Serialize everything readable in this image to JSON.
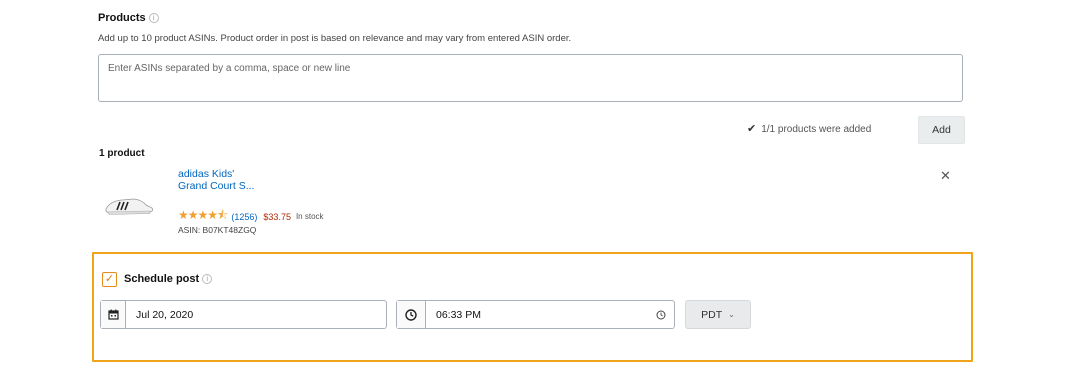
{
  "products": {
    "title": "Products",
    "description": "Add up to 10 product ASINs. Product order in post is based on relevance and may vary from entered ASIN order.",
    "input_value": "",
    "input_placeholder": "Enter ASINs separated by a comma, space or new line",
    "added_status": "1/1 products were added",
    "add_label": "Add",
    "count_label": "1 product"
  },
  "product": {
    "name_line1": "adidas Kids'",
    "name_line2": "Grand Court S...",
    "rating_stars": 4.5,
    "reviews": "(1256)",
    "price": "$33.75",
    "stock": "In stock",
    "asin": "ASIN: B07KT48ZGQ",
    "remove_glyph": "✕"
  },
  "schedule": {
    "checked": true,
    "label": "Schedule post",
    "date": "Jul 20, 2020",
    "time": "06:33 PM",
    "timezone": "PDT",
    "accent_color": "#f0a41c"
  },
  "icons": [
    "info-icon",
    "checkmark-icon",
    "close-icon",
    "calendar-icon",
    "clock-icon",
    "chevron-down-icon",
    "star-icon"
  ]
}
